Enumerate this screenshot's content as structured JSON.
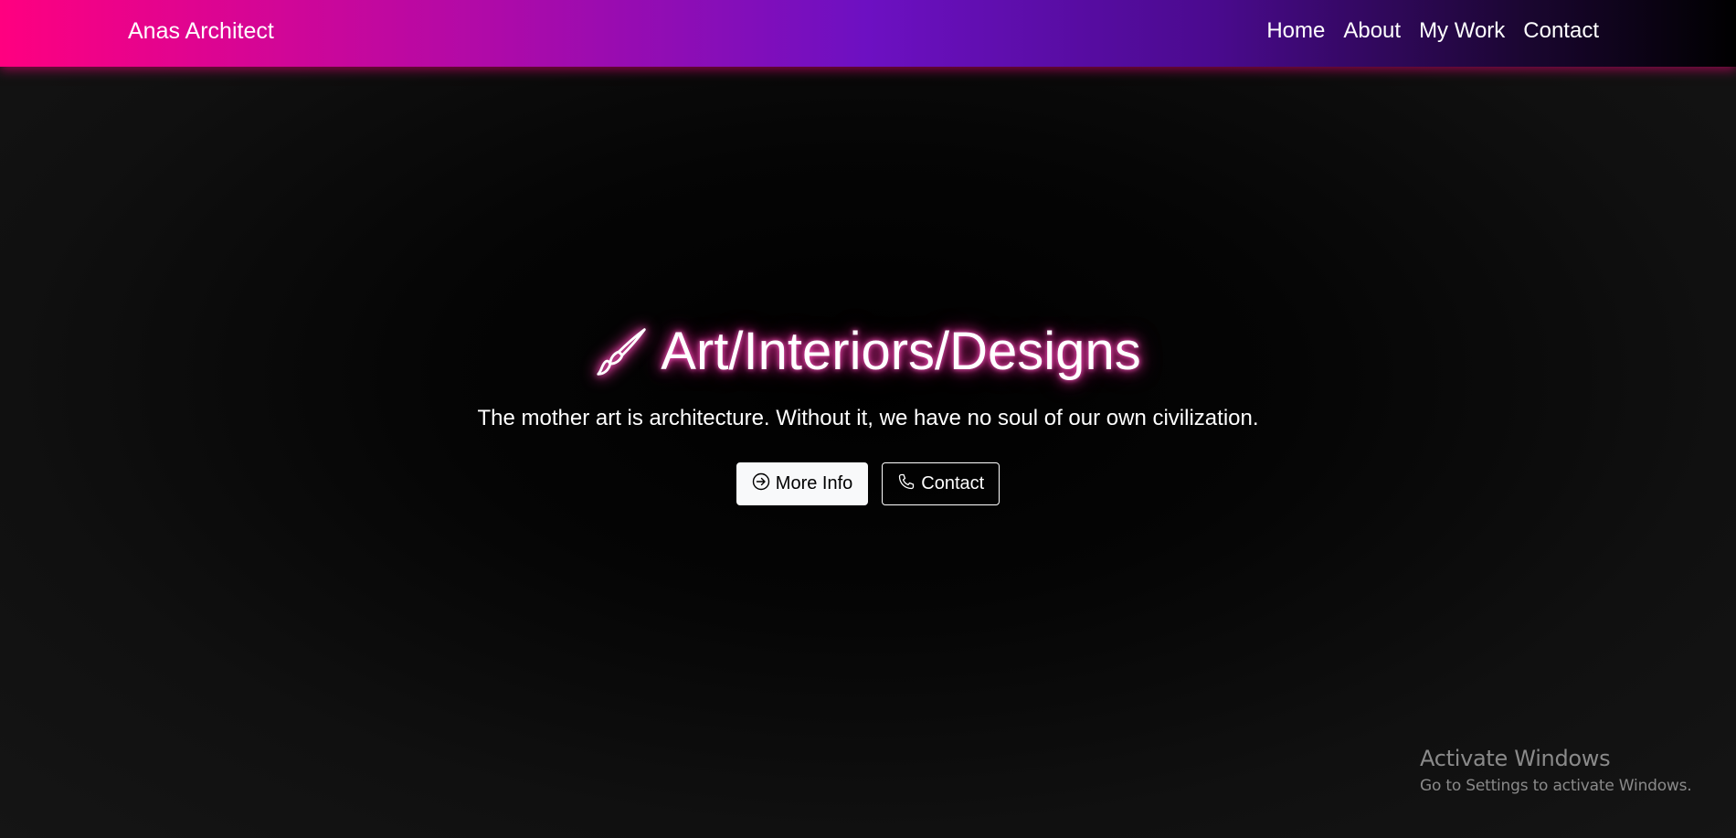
{
  "navbar": {
    "brand": "Anas Architect",
    "links": [
      {
        "label": "Home"
      },
      {
        "label": "About"
      },
      {
        "label": "My Work"
      },
      {
        "label": "Contact"
      }
    ],
    "gradient_colors": [
      "#ff0080",
      "#6d10c2",
      "#000000"
    ]
  },
  "hero": {
    "title": "Art/Interiors/Designs",
    "title_icon": "paintbrush-icon",
    "subtitle": "The mother art is architecture. Without it, we have no soul of our own civilization.",
    "glow_color": "#ff2fa8",
    "buttons": {
      "more_info": {
        "label": "More Info",
        "icon": "arrow-right-circle-icon"
      },
      "contact": {
        "label": "Contact",
        "icon": "telephone-icon"
      }
    }
  },
  "watermark": {
    "title": "Activate Windows",
    "subtitle": "Go to Settings to activate Windows."
  }
}
